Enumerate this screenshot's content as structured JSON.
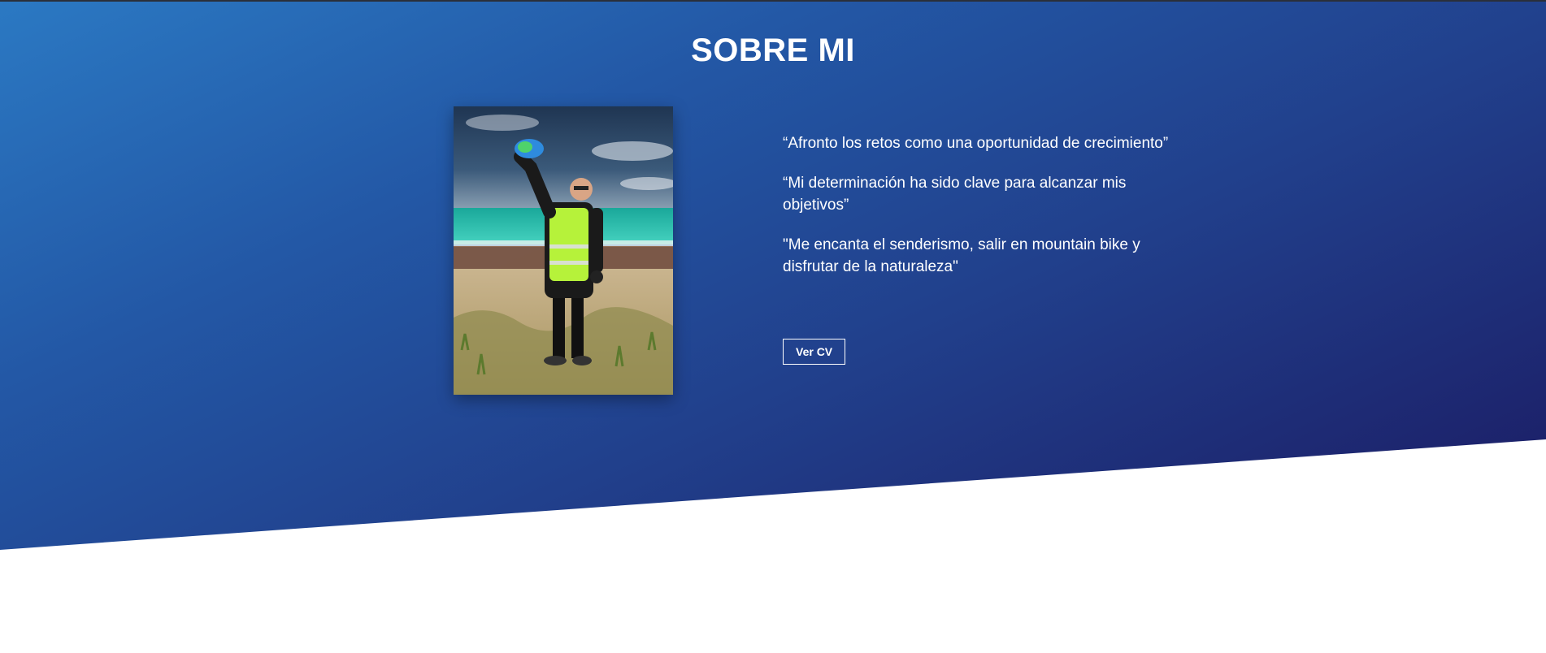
{
  "section": {
    "title": "SOBRE MI"
  },
  "photo": {
    "description": "profile-photo"
  },
  "quotes": [
    "“Afronto los retos como una oportunidad de crecimiento”",
    "“Mi determinación ha sido clave para alcanzar mis objetivos”",
    "\"Me encanta el senderismo, salir en mountain bike y disfrutar de la naturaleza\""
  ],
  "cv_button": {
    "label": "Ver CV"
  },
  "colors": {
    "gradient_start": "#2b79c3",
    "gradient_end": "#1b1a62",
    "text": "#ffffff"
  }
}
